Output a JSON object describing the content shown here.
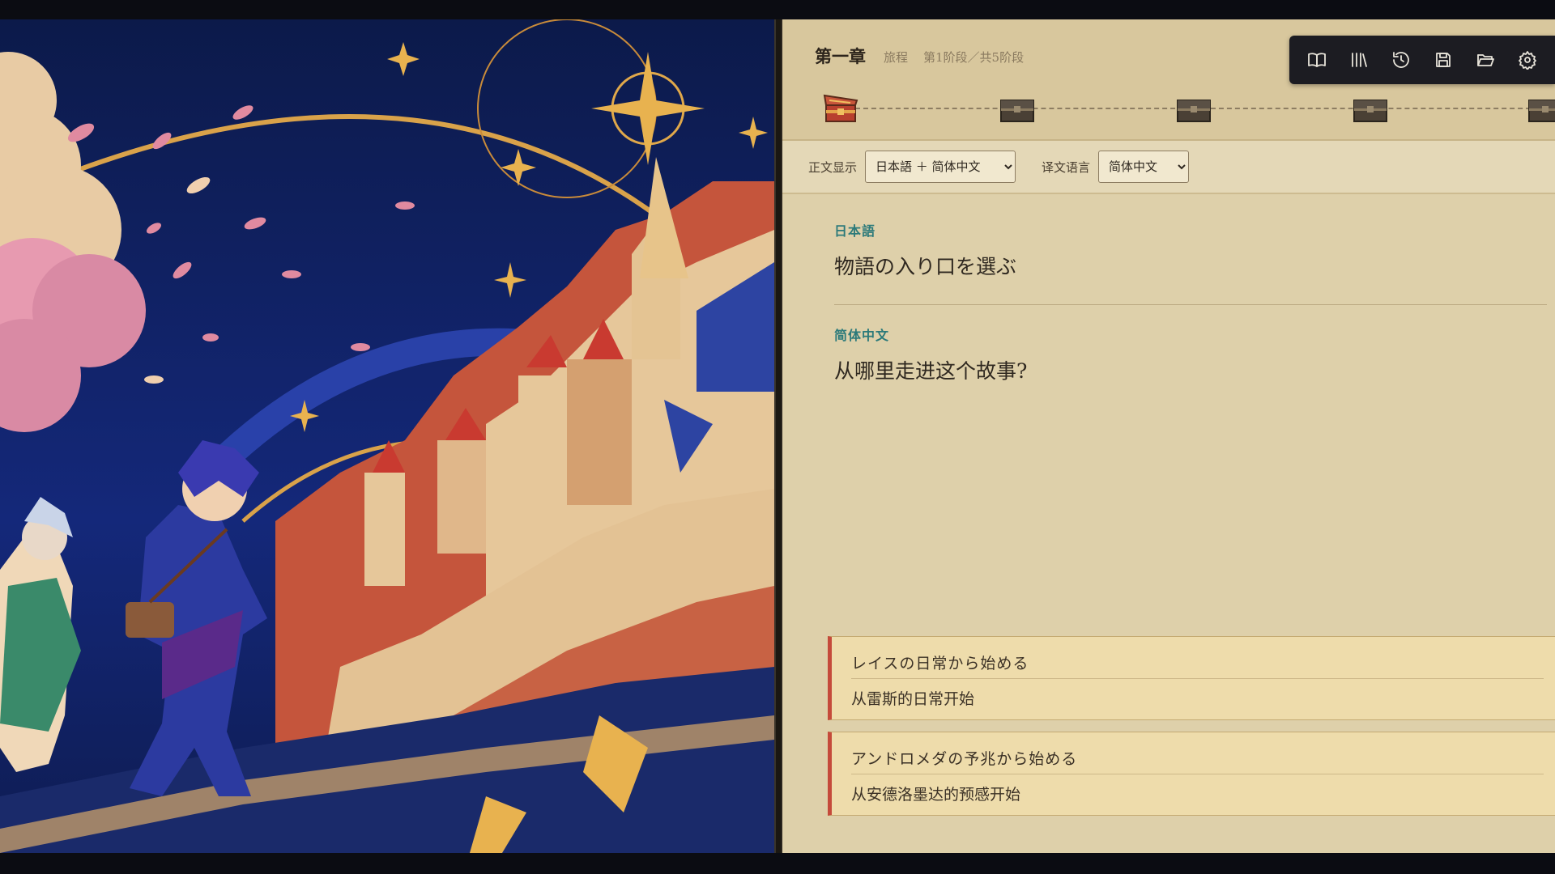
{
  "header": {
    "chapter": "第一章",
    "journey_label": "旅程",
    "stage_label": "第1阶段／共5阶段",
    "stages_total": 5,
    "current_stage": 1
  },
  "toolbar": {
    "icons": [
      "book-icon",
      "library-icon",
      "history-icon",
      "save-icon",
      "folder-open-icon",
      "gear-icon"
    ]
  },
  "controls": {
    "display_label": "正文显示",
    "display_value": "日本語 ＋ 简体中文",
    "lang_label": "译文语言",
    "lang_value": "简体中文"
  },
  "text": {
    "ja_tag": "日本語",
    "ja_line": "物語の入り口を選ぶ",
    "zh_tag": "简体中文",
    "zh_line": "从哪里走进这个故事?"
  },
  "choices": [
    {
      "ja": "レイスの日常から始める",
      "zh": "从雷斯的日常开始"
    },
    {
      "ja": "アンドロメダの予兆から始める",
      "zh": "从安德洛墨达的预感开始"
    }
  ],
  "colors": {
    "panel_bg": "#ded0aa",
    "accent_teal": "#2c7a7a",
    "choice_accent": "#c54a3a",
    "toolbar_bg": "#1c1c22"
  }
}
